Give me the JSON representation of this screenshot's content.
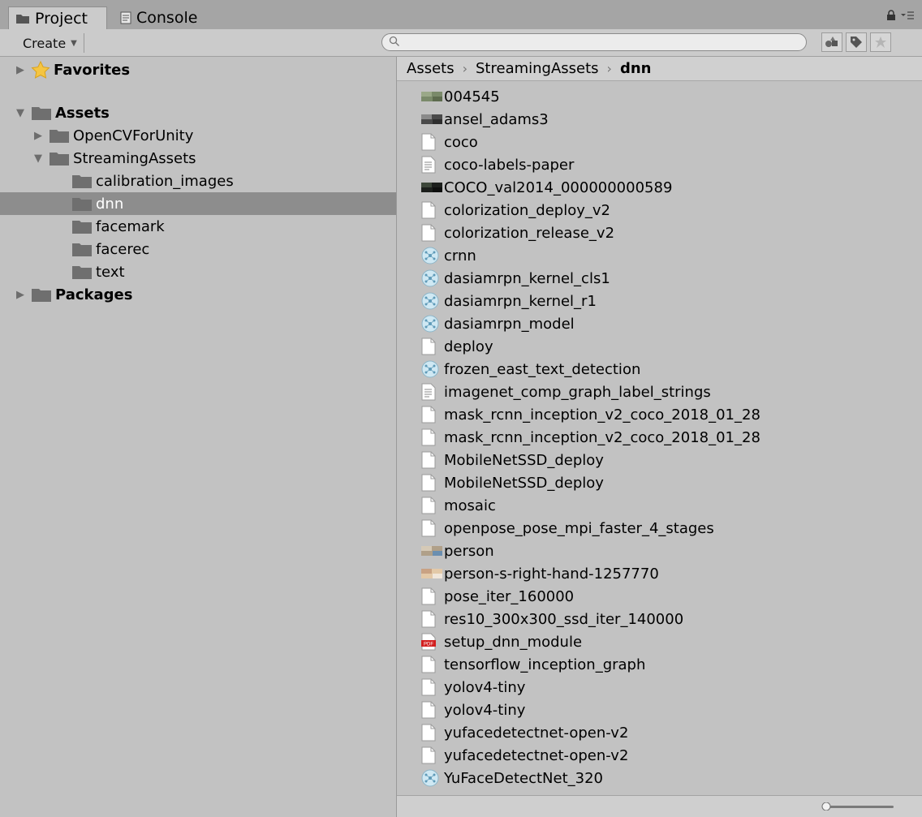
{
  "tabs": [
    {
      "label": "Project",
      "icon": "folder-icon",
      "active": true
    },
    {
      "label": "Console",
      "icon": "console-icon",
      "active": false
    }
  ],
  "toolbar": {
    "create_label": "Create",
    "search_value": ""
  },
  "tree": [
    {
      "label": "Favorites",
      "bold": true,
      "icon": "star-icon",
      "expanded": false
    },
    {
      "label": "Assets",
      "bold": true,
      "icon": "folder-icon",
      "expanded": true
    },
    {
      "label": "OpenCVForUnity",
      "bold": false,
      "icon": "folder-icon",
      "expanded": false
    },
    {
      "label": "StreamingAssets",
      "bold": false,
      "icon": "folder-icon",
      "expanded": true
    },
    {
      "label": "calibration_images",
      "bold": false,
      "icon": "folder-icon"
    },
    {
      "label": "dnn",
      "bold": false,
      "icon": "folder-icon",
      "selected": true
    },
    {
      "label": "facemark",
      "bold": false,
      "icon": "folder-icon"
    },
    {
      "label": "facerec",
      "bold": false,
      "icon": "folder-icon"
    },
    {
      "label": "text",
      "bold": false,
      "icon": "folder-icon"
    },
    {
      "label": "Packages",
      "bold": true,
      "icon": "folder-icon",
      "expanded": false
    }
  ],
  "breadcrumb": {
    "items": [
      "Assets",
      "StreamingAssets",
      "dnn"
    ],
    "separator": "›"
  },
  "files": [
    {
      "name": "004545",
      "icon": "image-thumb-icon"
    },
    {
      "name": "ansel_adams3",
      "icon": "image-thumb-icon"
    },
    {
      "name": "coco",
      "icon": "file-icon"
    },
    {
      "name": "coco-labels-paper",
      "icon": "text-file-icon"
    },
    {
      "name": "COCO_val2014_000000000589",
      "icon": "image-thumb-icon"
    },
    {
      "name": "colorization_deploy_v2",
      "icon": "file-icon"
    },
    {
      "name": "colorization_release_v2",
      "icon": "file-icon"
    },
    {
      "name": "crnn",
      "icon": "model-icon"
    },
    {
      "name": "dasiamrpn_kernel_cls1",
      "icon": "model-icon"
    },
    {
      "name": "dasiamrpn_kernel_r1",
      "icon": "model-icon"
    },
    {
      "name": "dasiamrpn_model",
      "icon": "model-icon"
    },
    {
      "name": "deploy",
      "icon": "file-icon"
    },
    {
      "name": "frozen_east_text_detection",
      "icon": "model-icon"
    },
    {
      "name": "imagenet_comp_graph_label_strings",
      "icon": "text-file-icon"
    },
    {
      "name": "mask_rcnn_inception_v2_coco_2018_01_28",
      "icon": "file-icon"
    },
    {
      "name": "mask_rcnn_inception_v2_coco_2018_01_28",
      "icon": "file-icon"
    },
    {
      "name": "MobileNetSSD_deploy",
      "icon": "file-icon"
    },
    {
      "name": "MobileNetSSD_deploy",
      "icon": "file-icon"
    },
    {
      "name": "mosaic",
      "icon": "file-icon"
    },
    {
      "name": "openpose_pose_mpi_faster_4_stages",
      "icon": "file-icon"
    },
    {
      "name": "person",
      "icon": "image-thumb-icon"
    },
    {
      "name": "person-s-right-hand-1257770",
      "icon": "image-thumb-icon"
    },
    {
      "name": "pose_iter_160000",
      "icon": "file-icon"
    },
    {
      "name": "res10_300x300_ssd_iter_140000",
      "icon": "file-icon"
    },
    {
      "name": "setup_dnn_module",
      "icon": "pdf-icon"
    },
    {
      "name": "tensorflow_inception_graph",
      "icon": "file-icon"
    },
    {
      "name": "yolov4-tiny",
      "icon": "file-icon"
    },
    {
      "name": "yolov4-tiny",
      "icon": "file-icon"
    },
    {
      "name": "yufacedetectnet-open-v2",
      "icon": "file-icon"
    },
    {
      "name": "yufacedetectnet-open-v2",
      "icon": "file-icon"
    },
    {
      "name": "YuFaceDetectNet_320",
      "icon": "model-icon"
    }
  ],
  "icon_size_slider": 0.0,
  "colors": {
    "panel_bg": "#c2c2c2",
    "selected_row": "#8d8d8d",
    "folder": "#6f6f6f"
  }
}
